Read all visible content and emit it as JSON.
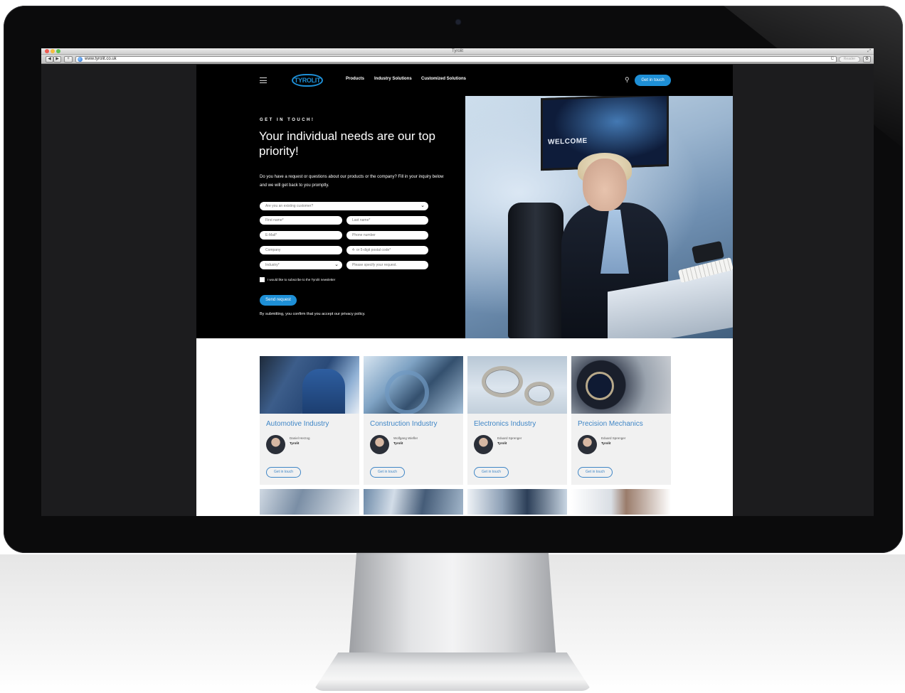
{
  "browser": {
    "window_title": "Tyrolit",
    "url": "www.tyrolit.co.uk",
    "reader_label": "Reader",
    "buttons": {
      "back": "◀",
      "forward": "▶",
      "add": "+",
      "settings": "⚙",
      "reload": "C"
    }
  },
  "nav": {
    "logo": "TYROLIT",
    "links": [
      "Products",
      "Industry Solutions",
      "Customized Solutions"
    ],
    "cta": "Get in touch",
    "icons": {
      "menu": "hamburger-menu-icon",
      "search": "search-icon"
    }
  },
  "hero": {
    "eyebrow": "GET IN TOUCH!",
    "title": "Your individual needs are our top priority!",
    "intro": "Do you have a request or questions about our products or the company? Fill in your inquiry below and we will get back to you promptly.",
    "photo_screen_text": "WELCOME"
  },
  "form": {
    "existing_customer": "Are you an existing customer?",
    "first_name": "First name*",
    "last_name": "Last name*",
    "email": "E-Mail*",
    "phone": "Phone number",
    "company": "Company",
    "postal": "4- or 5-digit postal code*",
    "industry": "Industry*",
    "request": "Please specify your request.",
    "newsletter": "I would like to subscribe to the Tyrolit newsletter",
    "submit": "Send request",
    "privacy": "By submitting, you confirm that you accept our privacy policy."
  },
  "industries": [
    {
      "title": "Automotive Industry",
      "contact": "Daniel Herzog",
      "company": "Tyrolit",
      "cta": "Get in touch"
    },
    {
      "title": "Construction Industry",
      "contact": "Wolfgang Wiefler",
      "company": "Tyrolit",
      "cta": "Get in touch"
    },
    {
      "title": "Electronics Industry",
      "contact": "Eduard Sprenger",
      "company": "Tyrolit",
      "cta": "Get in touch"
    },
    {
      "title": "Precision Mechanics",
      "contact": "Eduard Sprenger",
      "company": "Tyrolit",
      "cta": "Get in touch"
    }
  ],
  "colors": {
    "accent": "#1e8fd6",
    "link_blue": "#3f86c6",
    "hero_bg": "#000000"
  }
}
